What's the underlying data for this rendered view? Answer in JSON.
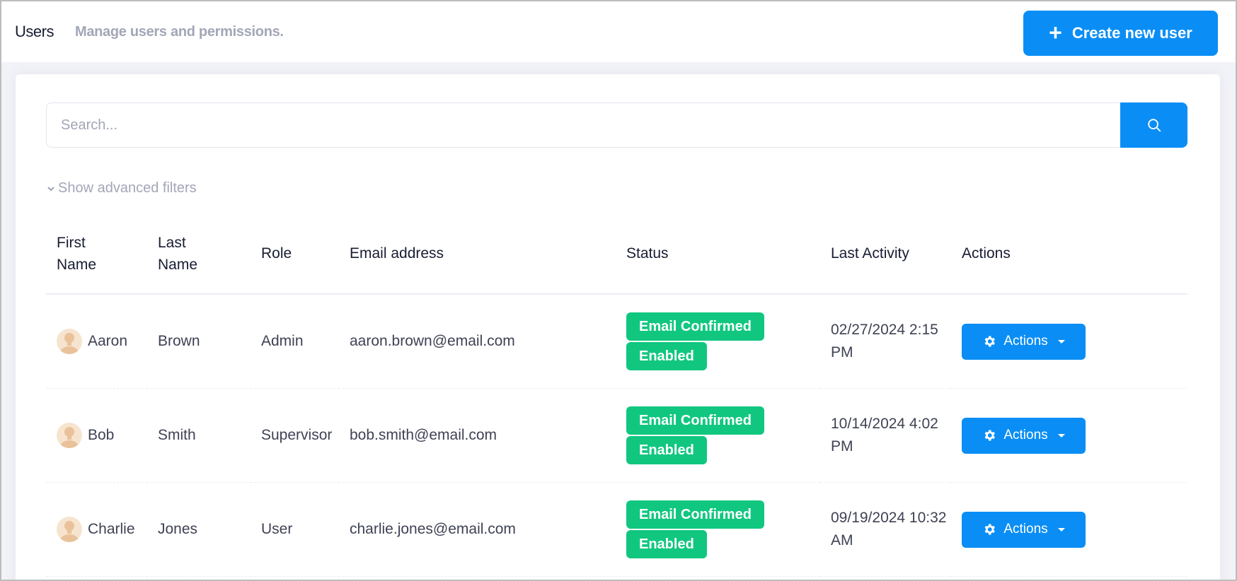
{
  "header": {
    "title": "Users",
    "subtitle": "Manage users and permissions.",
    "create_button_label": "Create new user"
  },
  "search": {
    "placeholder": "Search...",
    "value": ""
  },
  "filters": {
    "advanced_label": "Show advanced filters"
  },
  "table": {
    "columns": {
      "first_name": "First Name",
      "last_name": "Last Name",
      "role": "Role",
      "email": "Email address",
      "status": "Status",
      "last_activity": "Last Activity",
      "actions": "Actions"
    },
    "rows": [
      {
        "first_name": "Aaron",
        "last_name": "Brown",
        "role": "Admin",
        "email": "aaron.brown@email.com",
        "status": [
          "Email Confirmed",
          "Enabled"
        ],
        "last_activity": "02/27/2024 2:15 PM",
        "actions_label": "Actions"
      },
      {
        "first_name": "Bob",
        "last_name": "Smith",
        "role": "Supervisor",
        "email": "bob.smith@email.com",
        "status": [
          "Email Confirmed",
          "Enabled"
        ],
        "last_activity": "10/14/2024 4:02 PM",
        "actions_label": "Actions"
      },
      {
        "first_name": "Charlie",
        "last_name": "Jones",
        "role": "User",
        "email": "charlie.jones@email.com",
        "status": [
          "Email Confirmed",
          "Enabled"
        ],
        "last_activity": "09/19/2024 10:32 AM",
        "actions_label": "Actions"
      }
    ]
  },
  "colors": {
    "primary": "#0a8ef5",
    "success": "#11c77f",
    "muted_text": "#a3a6b7"
  },
  "icons": {
    "create": "plus-icon",
    "search": "search-icon",
    "filters": "chevron-down-icon",
    "avatar": "user-avatar-icon",
    "actions": "gear-icon"
  }
}
